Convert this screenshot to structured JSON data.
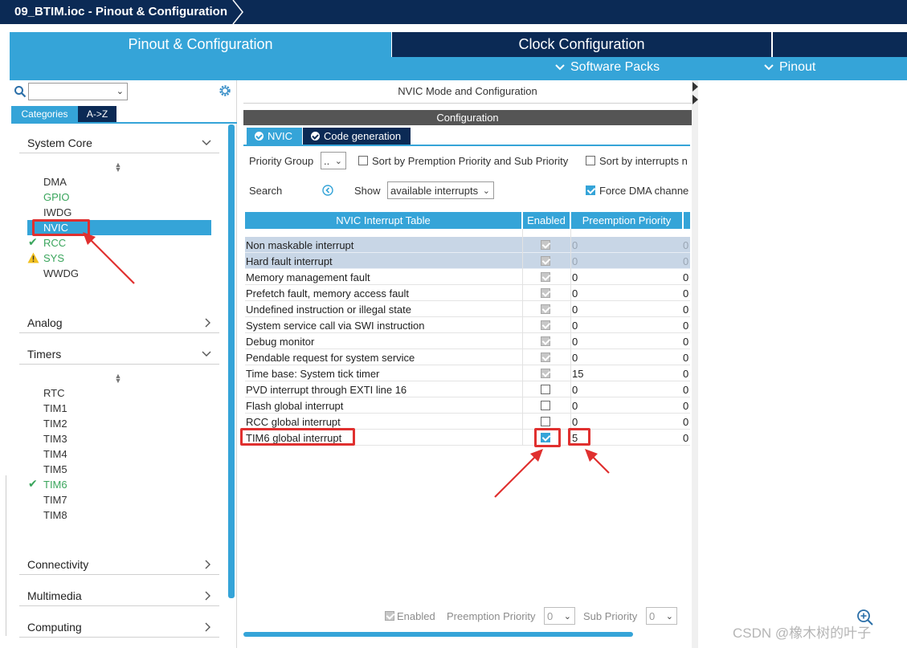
{
  "window": {
    "title": "09_BTIM.ioc - Pinout & Configuration"
  },
  "tabs": {
    "pinout_config": "Pinout & Configuration",
    "clock_config": "Clock Configuration"
  },
  "subbar": {
    "software_packs": "Software Packs",
    "pinout": "Pinout"
  },
  "sidebar": {
    "search_value": "",
    "tab_categories": "Categories",
    "tab_az": "A->Z",
    "system_core": {
      "label": "System Core",
      "items": [
        "DMA",
        "GPIO",
        "IWDG",
        "NVIC",
        "RCC",
        "SYS",
        "WWDG"
      ]
    },
    "analog": "Analog",
    "timers": {
      "label": "Timers",
      "items": [
        "RTC",
        "TIM1",
        "TIM2",
        "TIM3",
        "TIM4",
        "TIM5",
        "TIM6",
        "TIM7",
        "TIM8"
      ]
    },
    "connectivity": "Connectivity",
    "multimedia": "Multimedia",
    "computing": "Computing"
  },
  "main": {
    "mode_title": "NVIC Mode and Configuration",
    "config_title": "Configuration",
    "tab_nvic": "NVIC",
    "tab_codegen": "Code generation",
    "priority_group_label": "Priority Group",
    "priority_group_value": "..",
    "sort_premption_label": "Sort by Premption Priority and Sub Priority",
    "sort_interrupts_label": "Sort by interrupts n",
    "search_label": "Search",
    "show_label": "Show",
    "show_value": "available interrupts",
    "force_dma_label": "Force DMA channe",
    "table": {
      "headers": [
        "NVIC Interrupt Table",
        "Enabled",
        "Preemption Priority"
      ],
      "rows": [
        {
          "name": "Non maskable interrupt",
          "enabled": true,
          "preemption": "0",
          "sub": "0",
          "locked": true
        },
        {
          "name": "Hard fault interrupt",
          "enabled": true,
          "preemption": "0",
          "sub": "0",
          "locked": true
        },
        {
          "name": "Memory management fault",
          "enabled": true,
          "preemption": "0",
          "sub": "0",
          "locked": false
        },
        {
          "name": "Prefetch fault, memory access fault",
          "enabled": true,
          "preemption": "0",
          "sub": "0",
          "locked": false
        },
        {
          "name": "Undefined instruction or illegal state",
          "enabled": true,
          "preemption": "0",
          "sub": "0",
          "locked": false
        },
        {
          "name": "System service call via SWI instruction",
          "enabled": true,
          "preemption": "0",
          "sub": "0",
          "locked": false
        },
        {
          "name": "Debug monitor",
          "enabled": true,
          "preemption": "0",
          "sub": "0",
          "locked": false
        },
        {
          "name": "Pendable request for system service",
          "enabled": true,
          "preemption": "0",
          "sub": "0",
          "locked": false
        },
        {
          "name": "Time base: System tick timer",
          "enabled": true,
          "preemption": "15",
          "sub": "0",
          "locked": false
        },
        {
          "name": "PVD interrupt through EXTI line 16",
          "enabled": false,
          "preemption": "0",
          "sub": "0",
          "locked": false
        },
        {
          "name": "Flash global interrupt",
          "enabled": false,
          "preemption": "0",
          "sub": "0",
          "locked": false
        },
        {
          "name": "RCC global interrupt",
          "enabled": false,
          "preemption": "0",
          "sub": "0",
          "locked": false
        },
        {
          "name": "TIM6 global interrupt",
          "enabled": true,
          "preemption": "5",
          "sub": "0",
          "locked": false
        }
      ]
    },
    "bottom": {
      "enabled_label": "Enabled",
      "preemption_label": "Preemption Priority",
      "preemption_value": "0",
      "sub_label": "Sub Priority",
      "sub_value": "0"
    }
  },
  "watermark": "CSDN @橡木树的叶子",
  "colors": {
    "navy": "#0b2a55",
    "accent": "#35a4d8",
    "annotation_red": "#e0302f",
    "ok_green": "#3aa55c"
  }
}
